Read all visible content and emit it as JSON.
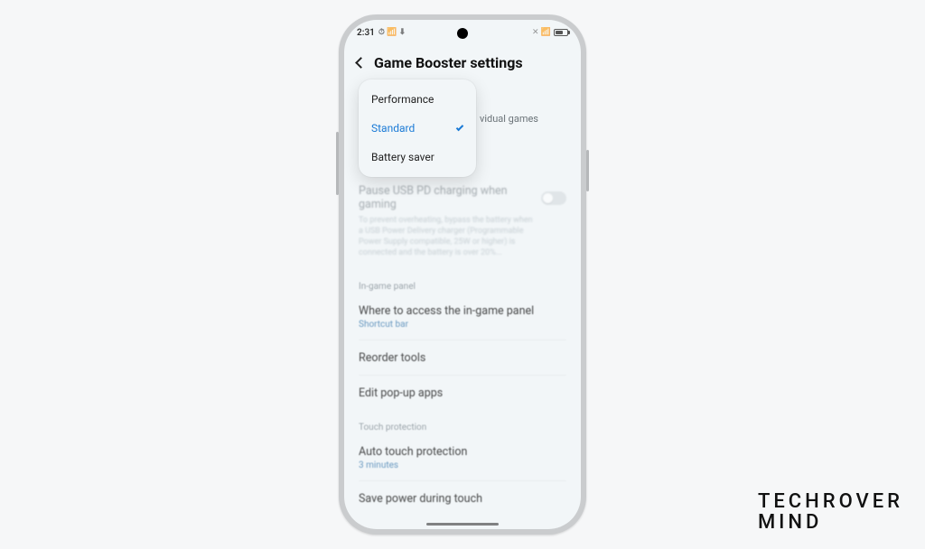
{
  "watermark": {
    "line1": "TECHROVER",
    "line2": "MIND"
  },
  "statusbar": {
    "time": "2:31",
    "left_icons": "⏱ 📶 ⬇",
    "right_icons": "✕ 📶"
  },
  "header": {
    "title": "Game Booster settings"
  },
  "perf_popup": {
    "options": [
      "Performance",
      "Standard",
      "Battery saver"
    ],
    "selected_index": 1
  },
  "peek_text": "vidual games",
  "pause_usb": {
    "title": "Pause USB PD charging when gaming",
    "desc": "To prevent overheating, bypass the battery when a USB Power Delivery charger (Programmable Power Supply compatible, 25W or higher) is connected and the battery is over 20%...",
    "toggle_on": false
  },
  "sections": {
    "in_game_panel": {
      "header": "In-game panel",
      "access": {
        "title": "Where to access the in-game panel",
        "value": "Shortcut bar"
      },
      "reorder": {
        "title": "Reorder tools"
      },
      "edit_popup": {
        "title": "Edit pop-up apps"
      }
    },
    "touch_protection": {
      "header": "Touch protection",
      "auto": {
        "title": "Auto touch protection",
        "value": "3 minutes"
      },
      "save_power": {
        "title": "Save power during touch"
      }
    }
  }
}
